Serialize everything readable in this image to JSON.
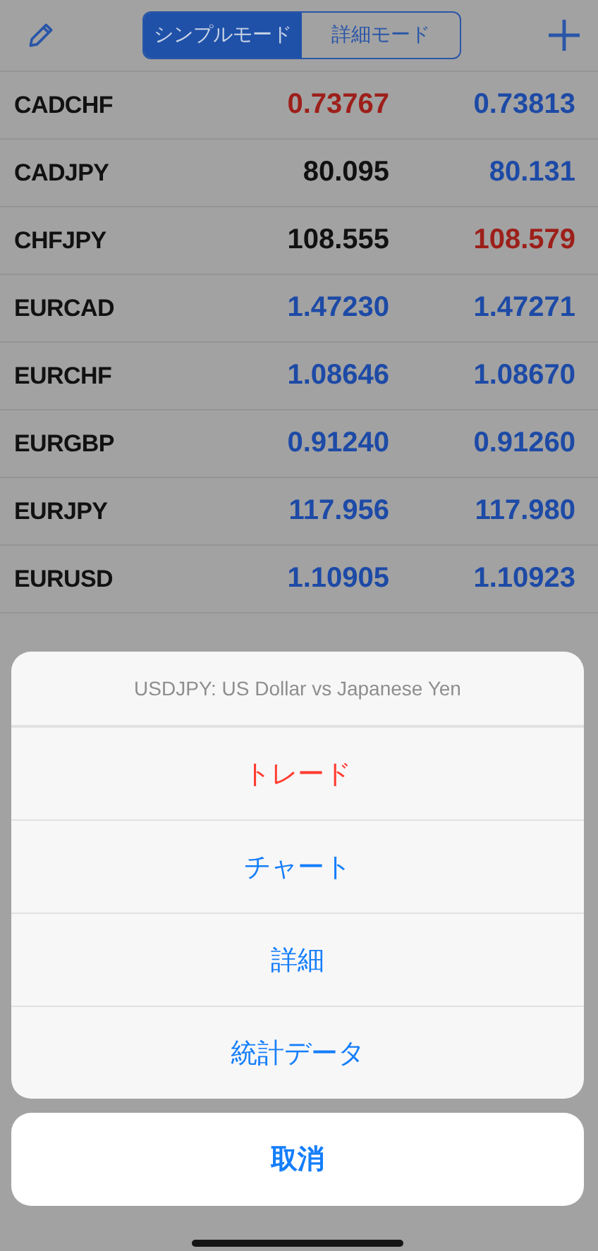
{
  "header": {
    "tabs": [
      {
        "label": "シンプルモード",
        "selected": true
      },
      {
        "label": "詳細モード",
        "selected": false
      }
    ]
  },
  "quotes": [
    {
      "symbol": "CADCHF",
      "bid": {
        "value": "0.73767",
        "color": "#9d1f1a"
      },
      "ask": {
        "value": "0.73813",
        "color": "#1d4aa6"
      }
    },
    {
      "symbol": "CADJPY",
      "bid": {
        "value": "80.095",
        "color": "#111111"
      },
      "ask": {
        "value": "80.131",
        "color": "#1d4aa6"
      }
    },
    {
      "symbol": "CHFJPY",
      "bid": {
        "value": "108.555",
        "color": "#111111"
      },
      "ask": {
        "value": "108.579",
        "color": "#9d1f1a"
      }
    },
    {
      "symbol": "EURCAD",
      "bid": {
        "value": "1.47230",
        "color": "#1d4aa6"
      },
      "ask": {
        "value": "1.47271",
        "color": "#1d4aa6"
      }
    },
    {
      "symbol": "EURCHF",
      "bid": {
        "value": "1.08646",
        "color": "#1d4aa6"
      },
      "ask": {
        "value": "1.08670",
        "color": "#1d4aa6"
      }
    },
    {
      "symbol": "EURGBP",
      "bid": {
        "value": "0.91240",
        "color": "#1d4aa6"
      },
      "ask": {
        "value": "0.91260",
        "color": "#1d4aa6"
      }
    },
    {
      "symbol": "EURJPY",
      "bid": {
        "value": "117.956",
        "color": "#1d4aa6"
      },
      "ask": {
        "value": "117.980",
        "color": "#1d4aa6"
      }
    },
    {
      "symbol": "EURUSD",
      "bid": {
        "value": "1.10905",
        "color": "#1d4aa6"
      },
      "ask": {
        "value": "1.10923",
        "color": "#1d4aa6"
      }
    }
  ],
  "action_sheet": {
    "title": "USDJPY: US Dollar vs Japanese Yen",
    "actions": [
      {
        "label": "トレード",
        "kind": "destructive"
      },
      {
        "label": "チャート",
        "kind": "default"
      },
      {
        "label": "詳細",
        "kind": "default"
      },
      {
        "label": "統計データ",
        "kind": "default"
      }
    ],
    "cancel": "取消"
  }
}
